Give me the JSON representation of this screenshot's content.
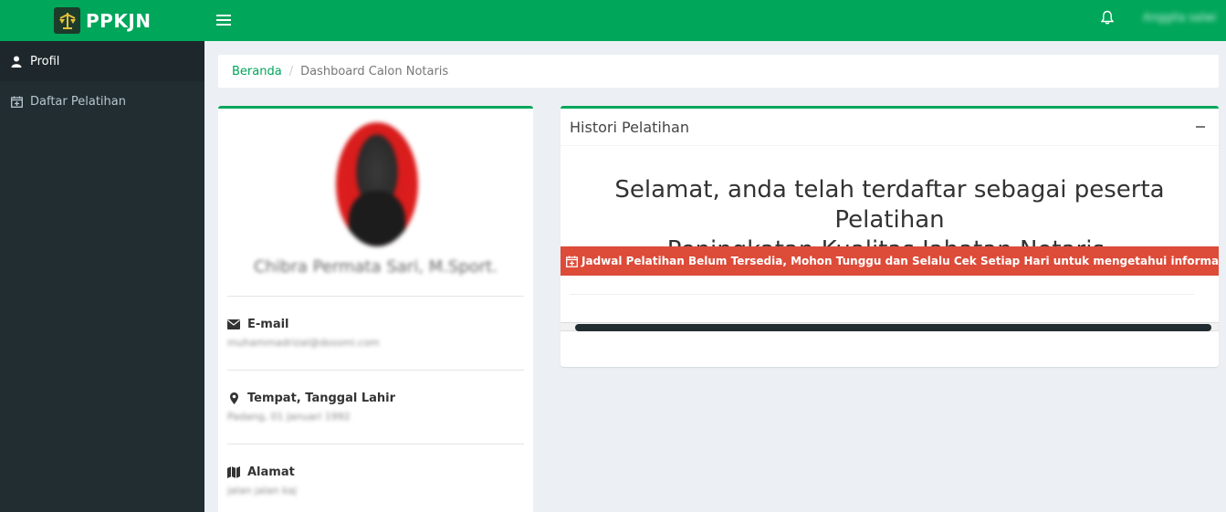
{
  "brand": {
    "name": "PPKJN"
  },
  "sidebar": {
    "items": [
      {
        "label": "Profil",
        "icon": "user-icon",
        "active": true
      },
      {
        "label": "Daftar Pelatihan",
        "icon": "calendar-plus-icon",
        "active": false
      }
    ]
  },
  "navbar": {
    "user_name": "Anggita salwi"
  },
  "breadcrumb": {
    "home": "Beranda",
    "current": "Dashboard Calon Notaris"
  },
  "profile": {
    "name": "Chibra Permata Sari, M.Sport.",
    "email_label": "E-mail",
    "email_value": "muhammadrizal@dossmi.com",
    "birth_label": "Tempat, Tanggal Lahir",
    "birth_value": "Padang, 01 Januari 1992",
    "address_label": "Alamat",
    "address_value": "jalan jalan kaj"
  },
  "histori": {
    "title": "Histori Pelatihan",
    "welcome": "Selamat, anda telah terdaftar sebagai peserta Pelatihan\nPeningkatan Kualitas Jabatan Notaris.",
    "alert": "Jadwal Pelatihan Belum Tersedia, Mohon Tunggu dan Selalu Cek Setiap Hari untuk mengetahui informasi jadwal."
  },
  "colors": {
    "brand": "#00a65a",
    "sidebar": "#222d32",
    "alert": "#dd4b39"
  }
}
